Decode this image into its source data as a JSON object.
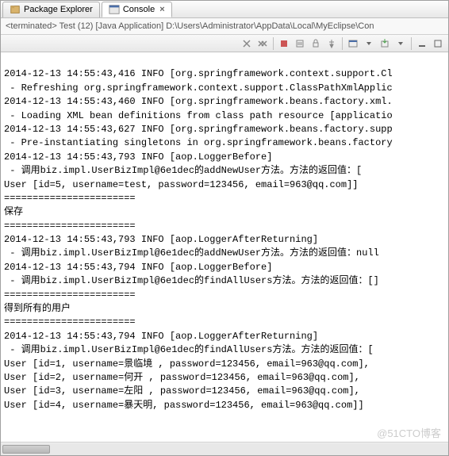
{
  "tabs": {
    "package_explorer": "Package Explorer",
    "console": "Console"
  },
  "status": "<terminated> Test (12) [Java Application] D:\\Users\\Administrator\\AppData\\Local\\MyEclipse\\Con",
  "console_lines": [
    "",
    "2014-12-13 14:55:43,416 INFO [org.springframework.context.support.Cl",
    " - Refreshing org.springframework.context.support.ClassPathXmlApplic",
    "2014-12-13 14:55:43,460 INFO [org.springframework.beans.factory.xml.",
    " - Loading XML bean definitions from class path resource [applicatio",
    "2014-12-13 14:55:43,627 INFO [org.springframework.beans.factory.supp",
    " - Pre-instantiating singletons in org.springframework.beans.factory",
    "2014-12-13 14:55:43,793 INFO [aop.LoggerBefore]",
    " - 调用biz.impl.UserBizImpl@6e1dec的addNewUser方法。方法的返回值：[",
    "User [id=5, username=test, password=123456, email=963@qq.com]]",
    "=======================",
    "保存",
    "=======================",
    "2014-12-13 14:55:43,793 INFO [aop.LoggerAfterReturning]",
    " - 调用biz.impl.UserBizImpl@6e1dec的addNewUser方法。方法的返回值：null",
    "2014-12-13 14:55:43,794 INFO [aop.LoggerBefore]",
    " - 调用biz.impl.UserBizImpl@6e1dec的findAllUsers方法。方法的返回值：[]",
    "=======================",
    "得到所有的用户",
    "=======================",
    "2014-12-13 14:55:43,794 INFO [aop.LoggerAfterReturning]",
    " - 调用biz.impl.UserBizImpl@6e1dec的findAllUsers方法。方法的返回值：[",
    "User [id=1, username=景临境 , password=123456, email=963@qq.com], ",
    "User [id=2, username=何开 , password=123456, email=963@qq.com], ",
    "User [id=3, username=左阳 , password=123456, email=963@qq.com], ",
    "User [id=4, username=暴天明, password=123456, email=963@qq.com]]",
    ""
  ],
  "watermark": "@51CTO博客"
}
